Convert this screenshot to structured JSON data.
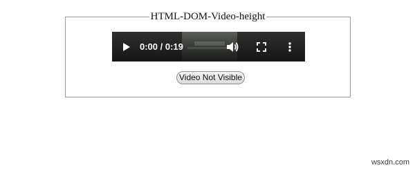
{
  "fieldset": {
    "legend": "HTML-DOM-Video-height"
  },
  "video": {
    "time_display": "0:00 / 0:19",
    "icons": {
      "play": "play-icon",
      "volume": "volume-icon",
      "fullscreen": "fullscreen-icon",
      "more": "more-options-icon"
    }
  },
  "button": {
    "label": "Video Not Visible"
  },
  "watermark": {
    "text": "wsxdn.com"
  }
}
